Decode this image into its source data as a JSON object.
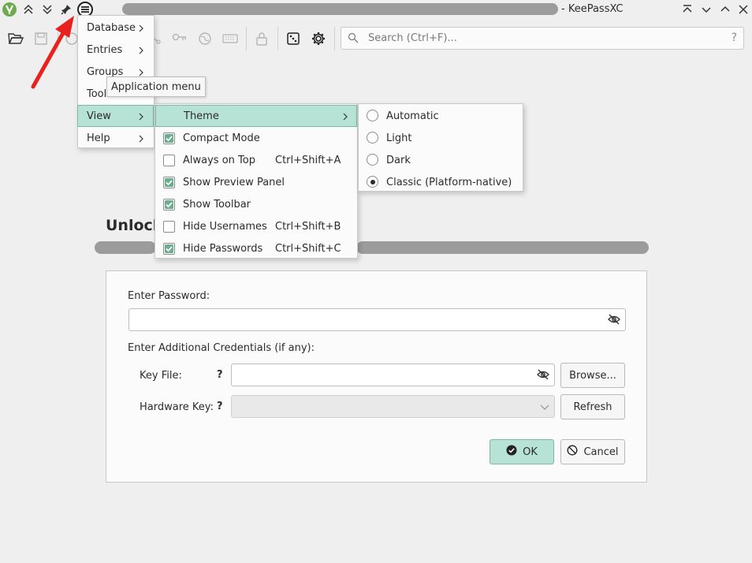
{
  "window": {
    "title_suffix": "- KeePassXC"
  },
  "toolbar": {
    "search_placeholder": "Search (Ctrl+F)...",
    "search_help": "?"
  },
  "tooltip": "Application menu",
  "app_menu": {
    "items": [
      {
        "label": "Database"
      },
      {
        "label": "Entries"
      },
      {
        "label": "Groups"
      },
      {
        "label": "Tool"
      },
      {
        "label": "View"
      },
      {
        "label": "Help"
      }
    ]
  },
  "view_menu": {
    "items": [
      {
        "label": "Theme",
        "shortcut": ""
      },
      {
        "label": "Compact Mode",
        "shortcut": "",
        "checked": true
      },
      {
        "label": "Always on Top",
        "shortcut": "Ctrl+Shift+A",
        "checked": false
      },
      {
        "label": "Show Preview Panel",
        "shortcut": "",
        "checked": true
      },
      {
        "label": "Show Toolbar",
        "shortcut": "",
        "checked": true
      },
      {
        "label": "Hide Usernames",
        "shortcut": "Ctrl+Shift+B",
        "checked": false
      },
      {
        "label": "Hide Passwords",
        "shortcut": "Ctrl+Shift+C",
        "checked": true
      }
    ]
  },
  "theme_menu": {
    "items": [
      {
        "label": "Automatic",
        "selected": false
      },
      {
        "label": "Light",
        "selected": false
      },
      {
        "label": "Dark",
        "selected": false
      },
      {
        "label": "Classic (Platform-native)",
        "selected": true
      }
    ]
  },
  "unlock": {
    "title": "Unlock",
    "password_label": "Enter Password:",
    "password_value": "",
    "additional_label": "Enter Additional Credentials (if any):",
    "key_file_label": "Key File:",
    "key_file_help": "?",
    "key_file_value": "",
    "browse_label": "Browse...",
    "hardware_key_label": "Hardware Key:",
    "hardware_key_help": "?",
    "refresh_label": "Refresh",
    "ok_label": "OK",
    "cancel_label": "Cancel"
  },
  "colors": {
    "accent": "#b7e2d6",
    "accent_border": "#7fb8a8",
    "pointer_arrow": "#e8211c",
    "app_logo": "#6cac4d"
  }
}
